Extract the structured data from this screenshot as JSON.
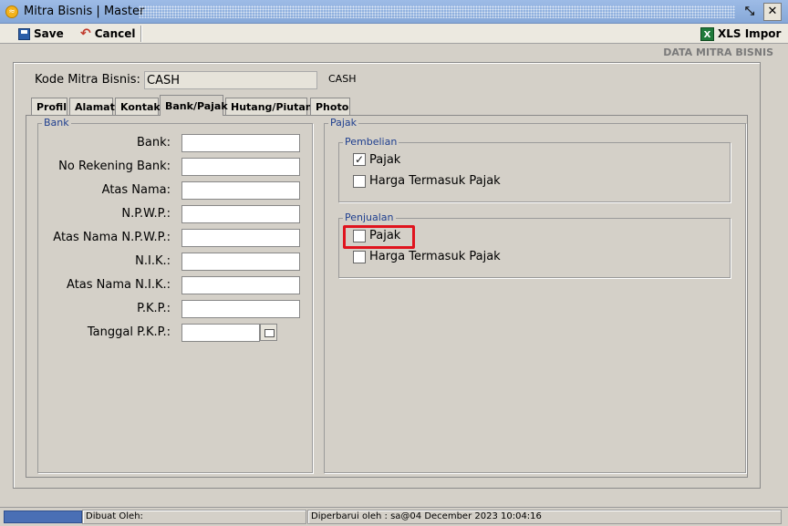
{
  "window": {
    "title": "Mitra Bisnis | Master"
  },
  "toolbar": {
    "save_label": "Save",
    "cancel_label": "Cancel",
    "import_label": "XLS Impor"
  },
  "section_title": "DATA MITRA BISNIS",
  "kode": {
    "label": "Kode Mitra Bisnis:",
    "value": "CASH",
    "tag": "CASH"
  },
  "tabs": [
    {
      "label": "Profil"
    },
    {
      "label": "Alamat"
    },
    {
      "label": "Kontak"
    },
    {
      "label": "Bank/Pajak"
    },
    {
      "label": "Hutang/Piutang"
    },
    {
      "label": "Photo"
    }
  ],
  "bank": {
    "legend": "Bank",
    "fields": [
      {
        "label": "Bank:"
      },
      {
        "label": "No Rekening Bank:"
      },
      {
        "label": "Atas Nama:"
      },
      {
        "label": "N.P.W.P.:"
      },
      {
        "label": "Atas Nama N.P.W.P.:"
      },
      {
        "label": "N.I.K.:"
      },
      {
        "label": "Atas Nama N.I.K.:"
      },
      {
        "label": "P.K.P.:"
      },
      {
        "label": "Tanggal P.K.P.:"
      }
    ]
  },
  "pajak": {
    "legend": "Pajak",
    "pembelian": {
      "legend": "Pembelian",
      "options": [
        {
          "label": "Pajak",
          "checked": true
        },
        {
          "label": "Harga Termasuk Pajak",
          "checked": false
        }
      ]
    },
    "penjualan": {
      "legend": "Penjualan",
      "options": [
        {
          "label": "Pajak",
          "checked": false
        },
        {
          "label": "Harga Termasuk Pajak",
          "checked": false
        }
      ]
    }
  },
  "status": {
    "dibuat": "Dibuat Oleh:",
    "diperbarui": "Diperbarui oleh : sa@04 December 2023  10:04:16"
  },
  "colors": {
    "highlight": "#e0141e",
    "legend": "#1f3f8f"
  }
}
